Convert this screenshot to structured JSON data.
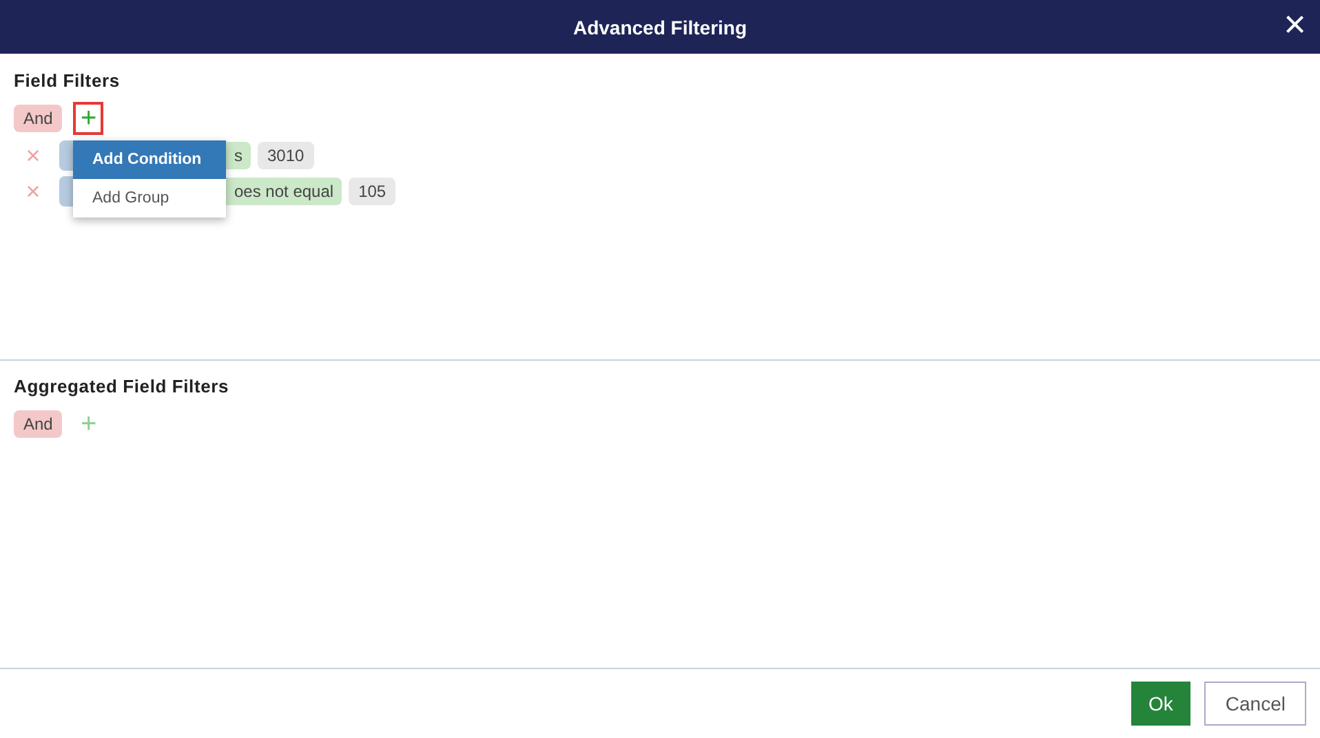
{
  "window": {
    "title": "Advanced Filtering",
    "close": "×"
  },
  "field_filters": {
    "title": "Field Filters",
    "operator": "And",
    "add": {
      "label": "+",
      "highlighted": true,
      "disabled": false
    },
    "conditions": [
      {
        "remove": "×",
        "operator": "s",
        "value": "3010"
      },
      {
        "remove": "×",
        "operator": "oes not equal",
        "value": "105"
      }
    ],
    "menu": [
      {
        "label": "Add Condition",
        "selected": true
      },
      {
        "label": "Add Group",
        "selected": false
      }
    ]
  },
  "aggregated_filters": {
    "title": "Aggregated Field Filters",
    "operator": "And",
    "add": {
      "label": "+",
      "highlighted": false,
      "disabled": true
    }
  },
  "buttons": [
    {
      "label": "Ok",
      "kind": "primary"
    },
    {
      "label": "Cancel",
      "kind": "secondary"
    }
  ]
}
